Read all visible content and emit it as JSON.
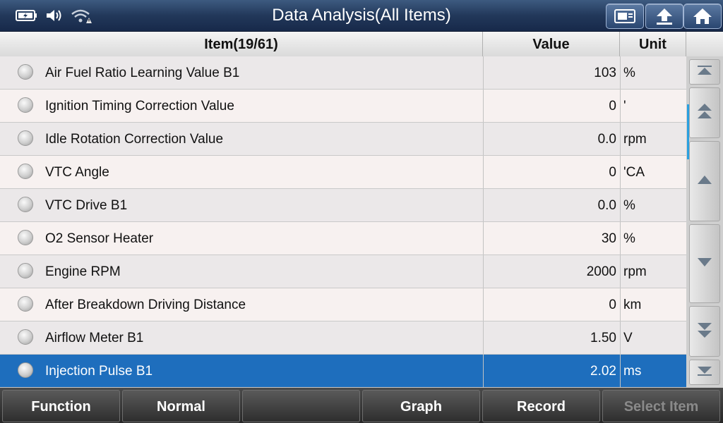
{
  "header": {
    "title": "Data Analysis(All Items)",
    "status_icons": [
      "battery-icon",
      "speaker-icon",
      "wifi-warning-icon"
    ],
    "nav_buttons": [
      "screenshot-icon",
      "back-icon",
      "home-icon"
    ]
  },
  "table": {
    "columns": {
      "item": "Item(19/61)",
      "value": "Value",
      "unit": "Unit"
    },
    "rows": [
      {
        "name": "Air Fuel Ratio Learning Value B1",
        "value": "103",
        "unit": "%"
      },
      {
        "name": "Ignition Timing Correction Value",
        "value": "0",
        "unit": "'"
      },
      {
        "name": "Idle Rotation Correction Value",
        "value": "0.0",
        "unit": "rpm"
      },
      {
        "name": "VTC Angle",
        "value": "0",
        "unit": "'CA"
      },
      {
        "name": "VTC Drive B1",
        "value": "0.0",
        "unit": "%"
      },
      {
        "name": "O2 Sensor Heater",
        "value": "30",
        "unit": "%"
      },
      {
        "name": "Engine RPM",
        "value": "2000",
        "unit": "rpm"
      },
      {
        "name": "After Breakdown Driving Distance",
        "value": "0",
        "unit": "km"
      },
      {
        "name": "Airflow Meter B1",
        "value": "1.50",
        "unit": "V"
      },
      {
        "name": "Injection Pulse B1",
        "value": "2.02",
        "unit": "ms",
        "selected": true
      }
    ]
  },
  "footer": {
    "buttons": [
      {
        "label": "Function",
        "enabled": true
      },
      {
        "label": "Normal",
        "enabled": true
      },
      {
        "label": "",
        "enabled": true
      },
      {
        "label": "Graph",
        "enabled": true
      },
      {
        "label": "Record",
        "enabled": true
      },
      {
        "label": "Select Item",
        "enabled": false
      }
    ]
  },
  "colors": {
    "selected_row": "#1e6ebd",
    "topbar": "#22385a",
    "scroll_thumb": "#2aa0e0"
  }
}
